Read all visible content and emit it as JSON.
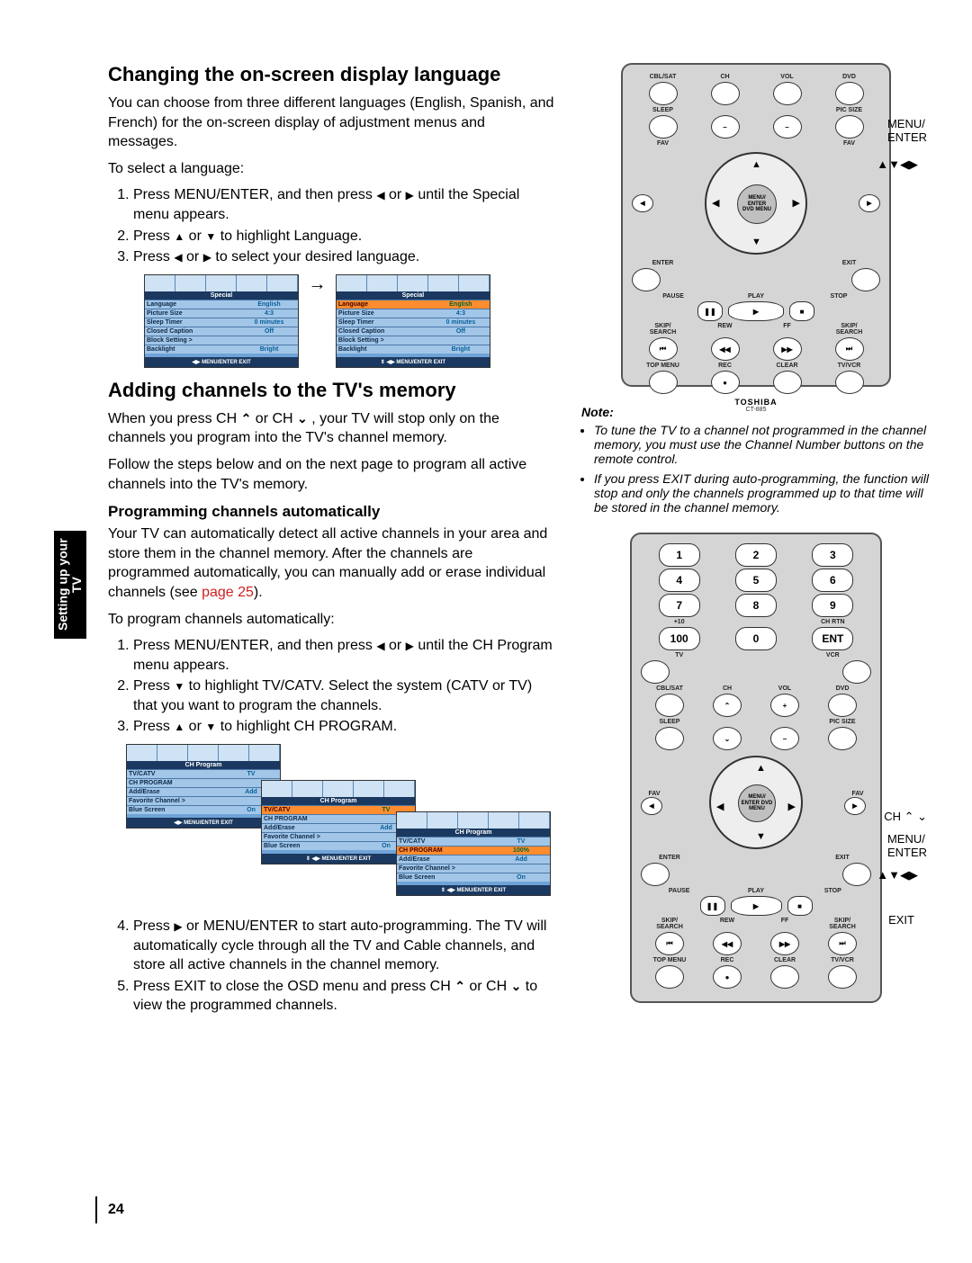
{
  "section_tab": "Setting up your TV",
  "page_number": "24",
  "h1": "Changing the on-screen display language",
  "intro1": "You can choose from three different languages (English, Spanish, and French) for the on-screen display of adjustment menus and messages.",
  "select_lang": "To select a language:",
  "step1a": "Press MENU/ENTER, and then press ",
  "step1b": " or ",
  "step1c": " until the Special menu appears.",
  "step2a": "Press ",
  "step2b": " or ",
  "step2c": " to highlight Language.",
  "step3a": "Press ",
  "step3b": " or ",
  "step3c": " to select your desired language.",
  "osd_special_title": "Special",
  "osd_rows_special": [
    {
      "l": "Language",
      "v": "English"
    },
    {
      "l": "Picture Size",
      "v": "4:3"
    },
    {
      "l": "Sleep Timer",
      "v": "0 minutes"
    },
    {
      "l": "Closed Caption",
      "v": "Off"
    },
    {
      "l": "Block Setting >",
      "v": ""
    },
    {
      "l": "Backlight",
      "v": "Bright"
    }
  ],
  "osd_footer": "◀▶ MENU/ENTER EXIT",
  "osd_footer2": "⇕ ◀▶ MENU/ENTER EXIT",
  "h2": "Adding channels to the TV's memory",
  "intro2a": "When you press CH ",
  "intro2b": " or CH ",
  "intro2c": " , your TV will stop only on the channels you program into the TV's channel memory.",
  "intro2d": "Follow the steps below and on the next page to program all active channels into the TV's memory.",
  "h3": "Programming channels automatically",
  "prog1a": "Your TV can automatically detect all active channels in your area and store them in the channel memory. After the channels are programmed automatically, you can manually add or erase individual channels (see ",
  "prog1b": "page 25",
  "prog1c": ").",
  "prog2": "To program channels automatically:",
  "pstep1a": "Press MENU/ENTER, and then press ",
  "pstep1b": " or ",
  "pstep1c": " until the CH Program menu appears.",
  "pstep2a": "Press ",
  "pstep2b": " to highlight TV/CATV. Select the system (CATV or TV) that you want to program the channels.",
  "pstep3a": "Press ",
  "pstep3b": " or ",
  "pstep3c": " to highlight CH PROGRAM.",
  "osd_ch_title": "CH Program",
  "osd_rows_ch": [
    {
      "l": "TV/CATV",
      "v": "TV"
    },
    {
      "l": "CH PROGRAM",
      "v": ""
    },
    {
      "l": "Add/Erase",
      "v": "Add"
    },
    {
      "l": "Favorite Channel >",
      "v": ""
    },
    {
      "l": "Blue Screen",
      "v": "On"
    }
  ],
  "osd_rows_ch2": [
    {
      "l": "TV/CATV",
      "v": "TV"
    },
    {
      "l": "CH PROGRAM",
      "v": ""
    },
    {
      "l": "Add/Erase",
      "v": "Add"
    },
    {
      "l": "Favorite Channel >",
      "v": ""
    },
    {
      "l": "Blue Screen",
      "v": "On"
    }
  ],
  "osd_rows_ch3": [
    {
      "l": "TV/CATV",
      "v": "TV"
    },
    {
      "l": "CH PROGRAM",
      "v": "100%"
    },
    {
      "l": "Add/Erase",
      "v": "Add"
    },
    {
      "l": "Favorite Channel >",
      "v": ""
    },
    {
      "l": "Blue Screen",
      "v": "On"
    }
  ],
  "pstep4a": "Press ",
  "pstep4b": " or MENU/ENTER to start auto-programming. The TV will automatically cycle through all the TV and Cable channels, and store all active channels in the channel memory.",
  "pstep5a": "Press EXIT to close the OSD menu and press CH ",
  "pstep5b": " or CH ",
  "pstep5c": " to view the programmed channels.",
  "callout_menu": "MENU/\nENTER",
  "callout_arrows": "▲▼◀▶",
  "callout_ch": "CH ⌃ ⌄",
  "callout_exit": "EXIT",
  "note_label": "Note:",
  "note1": "To tune the TV to a channel not programmed in the channel memory, you must use the Channel Number buttons on the remote control.",
  "note2": "If you press EXIT during auto-programming, the function will stop and only the channels programmed up to that time will be stored in the channel memory.",
  "remote_brand": "TOSHIBA",
  "remote_model": "CT-885",
  "dpad_center": "MENU/\nENTER\nDVD MENU",
  "btn_labels_top": [
    "CBL/SAT",
    "CH",
    "VOL",
    "DVD"
  ],
  "btn_labels_mid": [
    "SLEEP",
    "",
    "",
    "PIC SIZE"
  ],
  "btn_labels_fav": [
    "FAV",
    "",
    "",
    "FAV"
  ],
  "btn_labels_ee": [
    "ENTER",
    "",
    "",
    "EXIT"
  ],
  "btn_labels_play": [
    "PAUSE",
    "PLAY",
    "STOP"
  ],
  "btn_labels_skip": [
    "SKIP/\nSEARCH",
    "REW",
    "FF",
    "SKIP/\nSEARCH"
  ],
  "btn_labels_bot": [
    "TOP MENU",
    "REC",
    "CLEAR",
    "TV/VCR"
  ],
  "num_row4": [
    "100",
    "0",
    "ENT"
  ],
  "num_lbl4": [
    "+10",
    "",
    "CH RTN"
  ],
  "btn_labels_tvvcr": [
    "TV",
    "",
    "VCR"
  ]
}
